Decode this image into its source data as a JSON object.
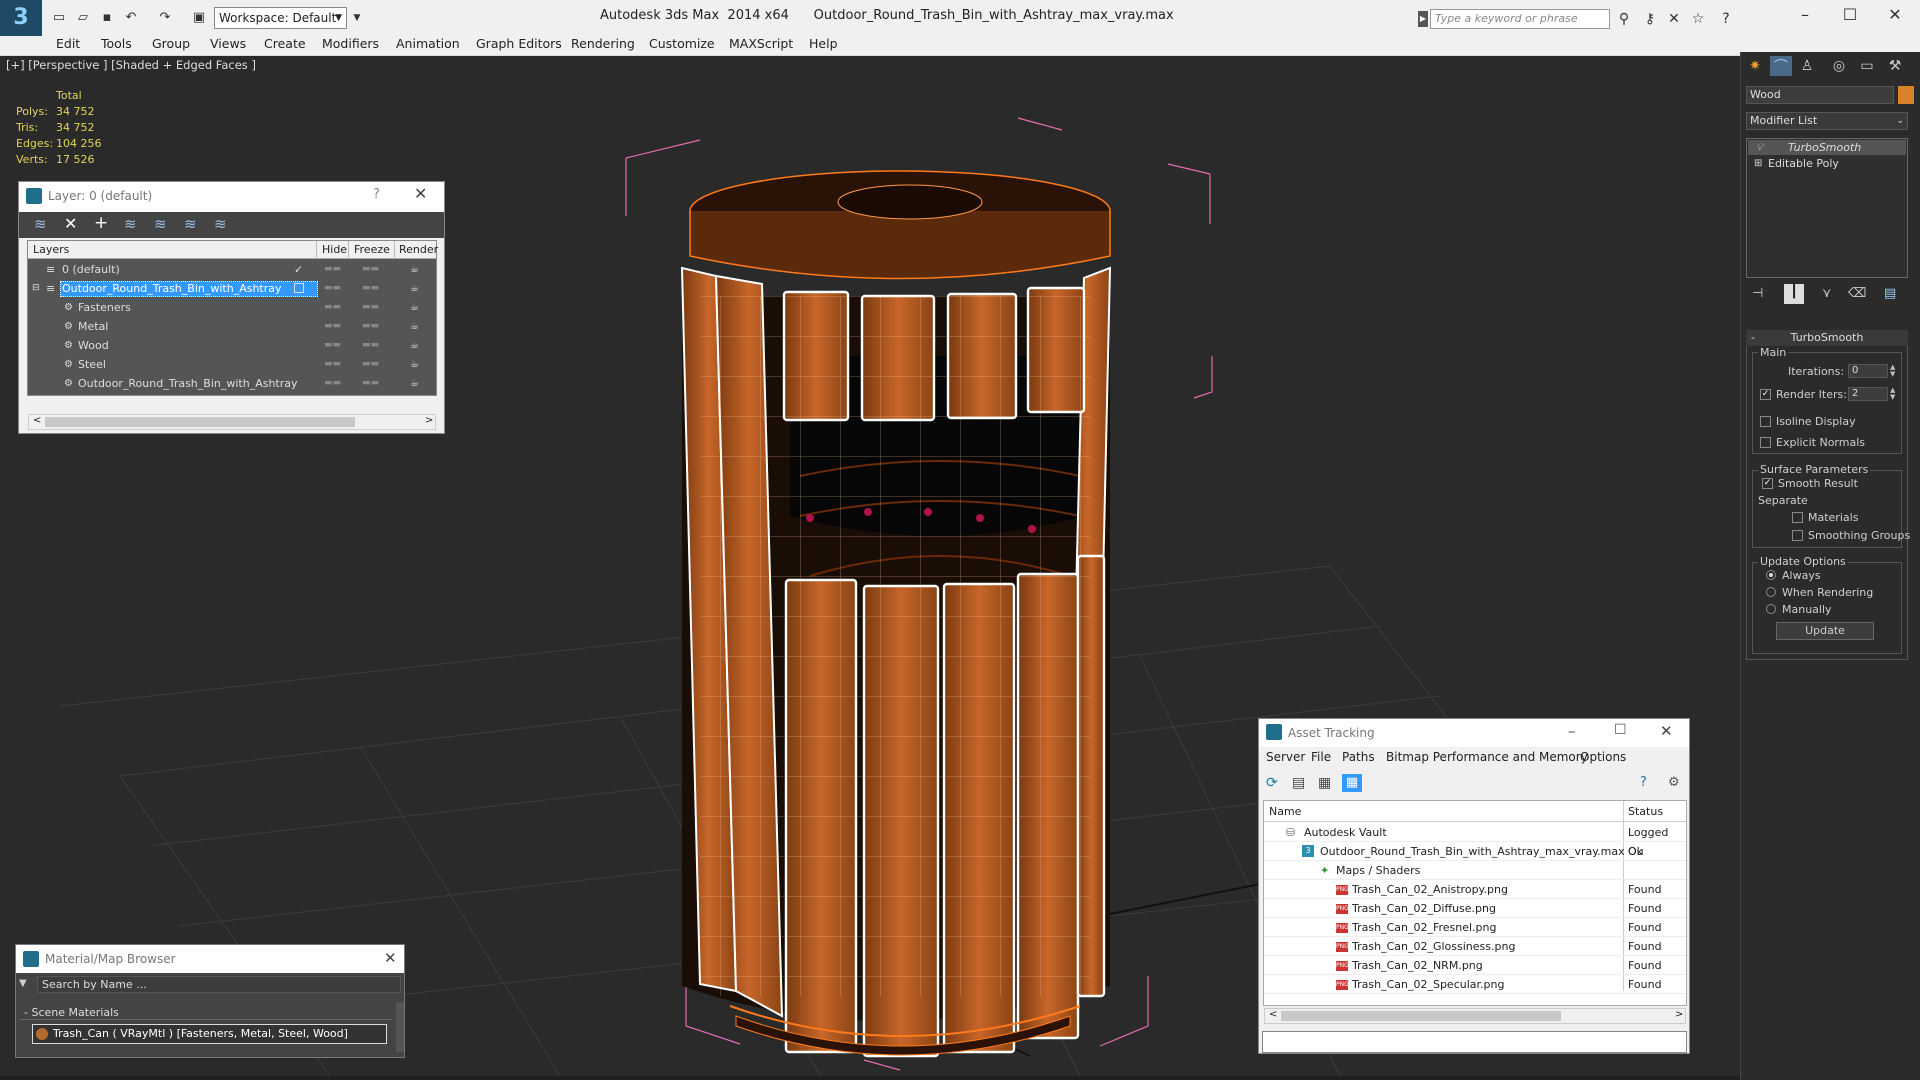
{
  "titlebar": {
    "app_title": "Autodesk 3ds Max  2014 x64      Outdoor_Round_Trash_Bin_with_Ashtray_max_vray.max",
    "workspace": "Workspace: Default",
    "search_placeholder": "Type a keyword or phrase"
  },
  "menu": {
    "items": [
      "Edit",
      "Tools",
      "Group",
      "Views",
      "Create",
      "Modifiers",
      "Animation",
      "Graph Editors",
      "Rendering",
      "Customize",
      "MAXScript",
      "Help"
    ]
  },
  "viewport": {
    "label": "[+] [Perspective ] [Shaded + Edged Faces ]",
    "stats": {
      "header": "Total",
      "rows": [
        {
          "label": "Polys:",
          "value": "34 752"
        },
        {
          "label": "Tris:",
          "value": "34 752"
        },
        {
          "label": "Edges:",
          "value": "104 256"
        },
        {
          "label": "Verts:",
          "value": "17 526"
        }
      ]
    }
  },
  "layer_window": {
    "title": "Layer: 0 (default)",
    "help": "?",
    "columns": [
      "Layers",
      "Hide",
      "Freeze",
      "Render"
    ],
    "rows": [
      {
        "name": "0 (default)",
        "selected": false,
        "indent": 0
      },
      {
        "name": "Outdoor_Round_Trash_Bin_with_Ashtray",
        "selected": true,
        "indent": 0
      },
      {
        "name": "Fasteners",
        "selected": false,
        "indent": 1
      },
      {
        "name": "Metal",
        "selected": false,
        "indent": 1
      },
      {
        "name": "Wood",
        "selected": false,
        "indent": 1
      },
      {
        "name": "Steel",
        "selected": false,
        "indent": 1
      },
      {
        "name": "Outdoor_Round_Trash_Bin_with_Ashtray",
        "selected": false,
        "indent": 1
      }
    ]
  },
  "material_browser": {
    "title": "Material/Map Browser",
    "search_placeholder": "Search by Name ...",
    "section": "- Scene Materials",
    "item": "Trash_Can  ( VRayMtl ) [Fasteners, Metal, Steel, Wood]"
  },
  "asset_tracking": {
    "title": "Asset Tracking",
    "menu": [
      "Server",
      "File",
      "Paths",
      "Bitmap Performance and Memory",
      "Options"
    ],
    "columns": [
      "Name",
      "Status"
    ],
    "rows": [
      {
        "name": "Autodesk Vault",
        "status": "Logged Ou",
        "level": 1,
        "icon": "vault"
      },
      {
        "name": "Outdoor_Round_Trash_Bin_with_Ashtray_max_vray.max",
        "status": "Ok",
        "level": 2,
        "icon": "max"
      },
      {
        "name": "Maps / Shaders",
        "status": "",
        "level": 3,
        "icon": "maps"
      },
      {
        "name": "Trash_Can_02_Anistropy.png",
        "status": "Found",
        "level": 4,
        "icon": "png"
      },
      {
        "name": "Trash_Can_02_Diffuse.png",
        "status": "Found",
        "level": 4,
        "icon": "png"
      },
      {
        "name": "Trash_Can_02_Fresnel.png",
        "status": "Found",
        "level": 4,
        "icon": "png"
      },
      {
        "name": "Trash_Can_02_Glossiness.png",
        "status": "Found",
        "level": 4,
        "icon": "png"
      },
      {
        "name": "Trash_Can_02_NRM.png",
        "status": "Found",
        "level": 4,
        "icon": "png"
      },
      {
        "name": "Trash_Can_02_Specular.png",
        "status": "Found",
        "level": 4,
        "icon": "png"
      }
    ]
  },
  "command_panel": {
    "object_name": "Wood",
    "object_color": "#d9822b",
    "modifier_list": "Modifier List",
    "stack": [
      "TurboSmooth",
      "Editable Poly"
    ],
    "rollout_title": "TurboSmooth",
    "main_group": "Main",
    "iterations_label": "Iterations:",
    "iterations_value": "0",
    "render_iters_label": "Render Iters:",
    "render_iters_value": "2",
    "isoline_label": "Isoline Display",
    "explicit_normals_label": "Explicit Normals",
    "surface_params_label": "Surface Parameters",
    "smooth_result_label": "Smooth Result",
    "separate_label": "Separate",
    "materials_label": "Materials",
    "smoothing_groups_label": "Smoothing Groups",
    "update_options_label": "Update Options",
    "always_label": "Always",
    "when_rendering_label": "When Rendering",
    "manually_label": "Manually",
    "update_button": "Update"
  },
  "colors": {
    "wood": "#b4581c",
    "wire": "#ff7a1a",
    "selection_blue": "#3399ff",
    "viewport_bg": "#2a2a2a"
  }
}
